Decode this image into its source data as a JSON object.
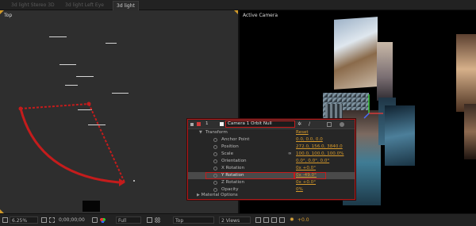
{
  "tabs": [
    {
      "label": "3d light Stereo 3D",
      "active": false
    },
    {
      "label": "3d light Left Eye",
      "active": false
    },
    {
      "label": "3d light",
      "active": true
    }
  ],
  "viewports": {
    "left_label": "Top",
    "right_label": "Active Camera"
  },
  "layer_panel": {
    "index": "1",
    "layer_name": "Camera 1 Orbit Null",
    "transform_label": "Transform",
    "reset_label": "Reset",
    "properties": [
      {
        "name": "Anchor Point",
        "value": "0.0, 0.0, 0.0"
      },
      {
        "name": "Position",
        "value": "272.0, 156.0, 3840.0"
      },
      {
        "name": "Scale",
        "value": "100.0, 100.0, 100.0%"
      },
      {
        "name": "Orientation",
        "value": "0.0°, 0.0°, 0.0°"
      },
      {
        "name": "X Rotation",
        "value": "0x +0.0°"
      },
      {
        "name": "Y Rotation",
        "value": "0x -49.0°",
        "highlighted": true
      },
      {
        "name": "Z Rotation",
        "value": "0x +0.0°"
      },
      {
        "name": "Opacity",
        "value": "0%"
      }
    ],
    "material_options_label": "Material Options"
  },
  "toolbar": {
    "zoom": "6.25%",
    "timecode": "0;00;00;00",
    "resolution": "Full",
    "view": "Top",
    "views": "2 Views",
    "exposure": "+0.0"
  },
  "colors": {
    "accent_red": "#c41c1c",
    "value_orange": "#d69a2c"
  }
}
